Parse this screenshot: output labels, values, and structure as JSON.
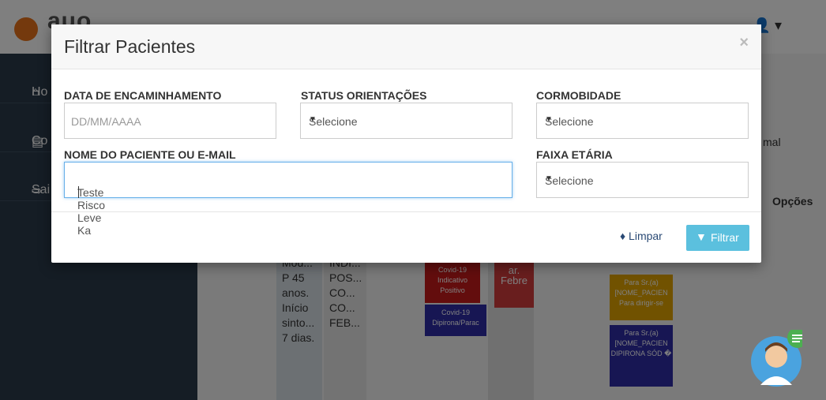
{
  "app": {
    "logo_text": "auo"
  },
  "sidebar": {
    "items": [
      {
        "label": "Ho",
        "icon": "home-icon"
      },
      {
        "label": "Co",
        "icon": "clipboard-icon"
      },
      {
        "label": "Sai",
        "icon": "logout-icon"
      }
    ]
  },
  "background": {
    "normal_text": "mal",
    "opcoes_header": "Opções",
    "patient_text": "Mod... P 45 anos. Início sinto... 7 dias.",
    "info_text": "INDI... POS... CO... CO... FEB...",
    "tags": [
      {
        "text": "Covid-19 Indicativo Positivo",
        "color": "#c61b1b"
      },
      {
        "text": "Covid-19 Dipirona/Parac",
        "color": "#2f2ca6"
      },
      {
        "text": "ar. Febre",
        "color": "#d23c3c"
      },
      {
        "text": "Para Sr.(a) [NOME_PACIEN Para dirigir-se",
        "color": "#e3a400"
      },
      {
        "text": "Para Sr.(a) [NOME_PACIEN DIPIRONA SÓD �",
        "color": "#2f2ca6"
      }
    ]
  },
  "modal": {
    "title": "Filtrar Pacientes",
    "close_label": "×",
    "fields": {
      "data_encaminhamento": {
        "label": "DATA DE ENCAMINHAMENTO",
        "placeholder": "DD/MM/AAAA",
        "value": ""
      },
      "status_orientacoes": {
        "label": "STATUS ORIENTAÇÕES",
        "value": "Selecione"
      },
      "cormobidade": {
        "label": "CORMOBIDADE",
        "value": "Selecione"
      },
      "nome_paciente": {
        "label": "NOME DO PACIENTE OU E-MAIL",
        "value": "Teste Risco Leve Ka"
      },
      "faixa_etaria": {
        "label": "FAIXA ETÁRIA",
        "value": "Selecione"
      }
    },
    "buttons": {
      "limpar": "Limpar",
      "filtrar": "Filtrar"
    }
  },
  "colors": {
    "filter_button": "#5bc0de",
    "sidebar": "#2b3a4a",
    "accent_orange": "#e8731a"
  }
}
